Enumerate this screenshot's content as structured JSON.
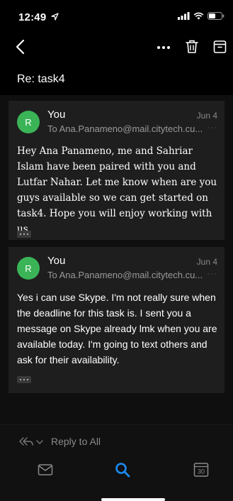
{
  "status_bar": {
    "time": "12:49",
    "icons": [
      "location-arrow-icon",
      "cellular-signal-icon",
      "wifi-icon",
      "battery-icon"
    ]
  },
  "nav": {
    "icons": [
      "chevron-left-icon",
      "more-horizontal-icon",
      "trash-icon",
      "archive-icon"
    ]
  },
  "subject": "Re: task4",
  "messages": [
    {
      "avatar_letter": "R",
      "avatar_color": "#3bb457",
      "sender": "You",
      "date": "Jun 4",
      "recipient": "To Ana.Panameno@mail.citytech.cu...",
      "more": "···",
      "body": "Hey Ana Panameno, me and Sahriar Islam have been paired with you and Lutfar Nahar. Let me know when are you guys available so we can get started on task4. Hope you will enjoy working with us."
    },
    {
      "avatar_letter": "R",
      "avatar_color": "#3bb457",
      "sender": "You",
      "date": "Jun 4",
      "recipient": "To Ana.Panameno@mail.citytech.cu...",
      "more": "···",
      "body": "Yes i can use Skype. I'm not really sure when the deadline for this task is. I sent you a message on Skype already lmk when you are available today. I'm going to text others and ask for their availability."
    }
  ],
  "reply_bar": {
    "label": "Reply to All",
    "icon": "reply-all-icon"
  },
  "tab_bar": {
    "tabs": [
      {
        "name": "mail",
        "icon": "mail-icon",
        "active": false
      },
      {
        "name": "search",
        "icon": "search-icon",
        "active": true
      },
      {
        "name": "calendar",
        "icon": "calendar-icon",
        "date_number": "30",
        "active": false
      }
    ]
  },
  "colors": {
    "accent": "#1a8cf0",
    "avatar": "#3bb457",
    "background": "#000000",
    "card": "#1e1e1e"
  }
}
